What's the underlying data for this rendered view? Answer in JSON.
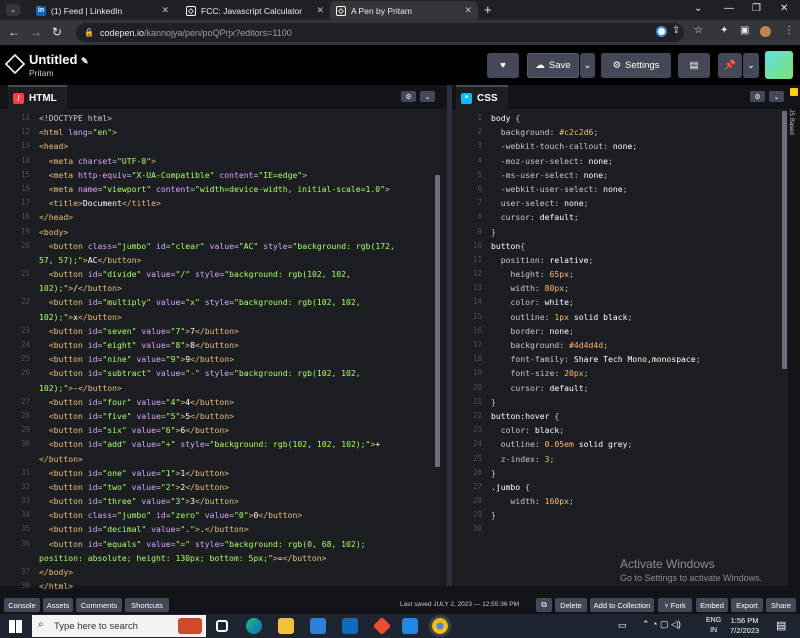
{
  "browser": {
    "tabs": [
      {
        "title": "(1) Feed | LinkedIn",
        "icon": "linkedin-icon"
      },
      {
        "title": "FCC: Javascript Calculator",
        "icon": "codepen-icon"
      },
      {
        "title": "A Pen by Pritam",
        "icon": "codepen-icon"
      }
    ],
    "active_tab": 2,
    "url_host": "codepen.io",
    "url_path": "/kannojya/pen/poQPrjx?editors=1100"
  },
  "pen": {
    "title": "Untitled",
    "user": "Pritam"
  },
  "header": {
    "save_label": "Save",
    "settings_label": "Settings"
  },
  "html_pane": {
    "label": "HTML"
  },
  "css_pane": {
    "label": "CSS",
    "sidebar_label": "JS Based"
  },
  "html_code": [
    {
      "n": "11",
      "html": "<span class='punc'>&lt;!DOCTYPE html&gt;</span>"
    },
    {
      "n": "12",
      "html": "<span class='tag'>&lt;html</span> <span class='attr'>lang</span>=<span class='val'>\"en\"</span><span class='tag'>&gt;</span>"
    },
    {
      "n": "13",
      "html": "<span class='tag'>&lt;head&gt;</span>"
    },
    {
      "n": "14",
      "html": "  <span class='tag'>&lt;meta</span> <span class='attr'>charset</span>=<span class='val'>\"UTF-8\"</span><span class='tag'>&gt;</span>"
    },
    {
      "n": "15",
      "html": "  <span class='tag'>&lt;meta</span> <span class='attr'>http-equiv</span>=<span class='val'>\"X-UA-Compatible\"</span> <span class='attr'>content</span>=<span class='val'>\"IE=edge\"</span><span class='tag'>&gt;</span>"
    },
    {
      "n": "16",
      "html": "  <span class='tag'>&lt;meta</span> <span class='attr'>name</span>=<span class='val'>\"viewport\"</span> <span class='attr'>content</span>=<span class='val'>\"width=device-width, initial-scale=1.0\"</span><span class='tag'>&gt;</span>"
    },
    {
      "n": "17",
      "html": "  <span class='tag'>&lt;title&gt;</span><span class='txt'>Document</span><span class='tag'>&lt;/title&gt;</span>"
    },
    {
      "n": "18",
      "html": "<span class='tag'>&lt;/head&gt;</span>"
    },
    {
      "n": "19",
      "html": "<span class='tag'>&lt;body&gt;</span>"
    },
    {
      "n": "20",
      "html": "  <span class='tag'>&lt;button</span> <span class='attr'>class</span>=<span class='val'>\"jumbo\"</span> <span class='attr'>id</span>=<span class='val'>\"clear\"</span> <span class='attr'>value</span>=<span class='val'>\"AC\"</span> <span class='attr'>style</span>=<span class='val'>\"background: rgb(172,</span>"
    },
    {
      "n": "",
      "html": "<span class='val'>57, 57);\"</span><span class='tag'>&gt;</span><span class='txt'>AC</span><span class='tag'>&lt;/button&gt;</span>"
    },
    {
      "n": "21",
      "html": "  <span class='tag'>&lt;button</span> <span class='attr'>id</span>=<span class='val'>\"divide\"</span> <span class='attr'>value</span>=<span class='val'>\"/\"</span> <span class='attr'>style</span>=<span class='val'>\"background: rgb(102, 102,</span>"
    },
    {
      "n": "",
      "html": "<span class='val'>102);\"</span><span class='tag'>&gt;</span><span class='txt'>/</span><span class='tag'>&lt;/button&gt;</span>"
    },
    {
      "n": "22",
      "html": "  <span class='tag'>&lt;button</span> <span class='attr'>id</span>=<span class='val'>\"multiply\"</span> <span class='attr'>value</span>=<span class='val'>\"x\"</span> <span class='attr'>style</span>=<span class='val'>\"background: rgb(102, 102,</span>"
    },
    {
      "n": "",
      "html": "<span class='val'>102);\"</span><span class='tag'>&gt;</span><span class='txt'>x</span><span class='tag'>&lt;/button&gt;</span>"
    },
    {
      "n": "23",
      "html": "  <span class='tag'>&lt;button</span> <span class='attr'>id</span>=<span class='val'>\"seven\"</span> <span class='attr'>value</span>=<span class='val'>\"7\"</span><span class='tag'>&gt;</span><span class='txt'>7</span><span class='tag'>&lt;/button&gt;</span>"
    },
    {
      "n": "24",
      "html": "  <span class='tag'>&lt;button</span> <span class='attr'>id</span>=<span class='val'>\"eight\"</span> <span class='attr'>value</span>=<span class='val'>\"8\"</span><span class='tag'>&gt;</span><span class='txt'>8</span><span class='tag'>&lt;/button&gt;</span>"
    },
    {
      "n": "25",
      "html": "  <span class='tag'>&lt;button</span> <span class='attr'>id</span>=<span class='val'>\"nine\"</span> <span class='attr'>value</span>=<span class='val'>\"9\"</span><span class='tag'>&gt;</span><span class='txt'>9</span><span class='tag'>&lt;/button&gt;</span>"
    },
    {
      "n": "26",
      "html": "  <span class='tag'>&lt;button</span> <span class='attr'>id</span>=<span class='val'>\"subtract\"</span> <span class='attr'>value</span>=<span class='val'>\"-\"</span> <span class='attr'>style</span>=<span class='val'>\"background: rgb(102, 102,</span>"
    },
    {
      "n": "",
      "html": "<span class='val'>102);\"</span><span class='tag'>&gt;</span><span class='txt'>-</span><span class='tag'>&lt;/button&gt;</span>"
    },
    {
      "n": "27",
      "html": "  <span class='tag'>&lt;button</span> <span class='attr'>id</span>=<span class='val'>\"four\"</span> <span class='attr'>value</span>=<span class='val'>\"4\"</span><span class='tag'>&gt;</span><span class='txt'>4</span><span class='tag'>&lt;/button&gt;</span>"
    },
    {
      "n": "28",
      "html": "  <span class='tag'>&lt;button</span> <span class='attr'>id</span>=<span class='val'>\"five\"</span> <span class='attr'>value</span>=<span class='val'>\"5\"</span><span class='tag'>&gt;</span><span class='txt'>5</span><span class='tag'>&lt;/button&gt;</span>"
    },
    {
      "n": "29",
      "html": "  <span class='tag'>&lt;button</span> <span class='attr'>id</span>=<span class='val'>\"six\"</span> <span class='attr'>value</span>=<span class='val'>\"6\"</span><span class='tag'>&gt;</span><span class='txt'>6</span><span class='tag'>&lt;/button&gt;</span>"
    },
    {
      "n": "30",
      "html": "  <span class='tag'>&lt;button</span> <span class='attr'>id</span>=<span class='val'>\"add\"</span> <span class='attr'>value</span>=<span class='val'>\"+\"</span> <span class='attr'>style</span>=<span class='val'>\"background: rgb(102, 102, 102);\"</span><span class='tag'>&gt;</span><span class='txt'>+</span>"
    },
    {
      "n": "",
      "html": "<span class='tag'>&lt;/button&gt;</span>"
    },
    {
      "n": "31",
      "html": "  <span class='tag'>&lt;button</span> <span class='attr'>id</span>=<span class='val'>\"one\"</span> <span class='attr'>value</span>=<span class='val'>\"1\"</span><span class='tag'>&gt;</span><span class='txt'>1</span><span class='tag'>&lt;/button&gt;</span>"
    },
    {
      "n": "32",
      "html": "  <span class='tag'>&lt;button</span> <span class='attr'>id</span>=<span class='val'>\"two\"</span> <span class='attr'>value</span>=<span class='val'>\"2\"</span><span class='tag'>&gt;</span><span class='txt'>2</span><span class='tag'>&lt;/button&gt;</span>"
    },
    {
      "n": "33",
      "html": "  <span class='tag'>&lt;button</span> <span class='attr'>id</span>=<span class='val'>\"three\"</span> <span class='attr'>value</span>=<span class='val'>\"3\"</span><span class='tag'>&gt;</span><span class='txt'>3</span><span class='tag'>&lt;/button&gt;</span>"
    },
    {
      "n": "34",
      "html": "  <span class='tag'>&lt;button</span> <span class='attr'>class</span>=<span class='val'>\"jumbo\"</span> <span class='attr'>id</span>=<span class='val'>\"zero\"</span> <span class='attr'>value</span>=<span class='val'>\"0\"</span><span class='tag'>&gt;</span><span class='txt'>0</span><span class='tag'>&lt;/button&gt;</span>"
    },
    {
      "n": "35",
      "html": "  <span class='tag'>&lt;button</span> <span class='attr'>id</span>=<span class='val'>\"decimal\"</span> <span class='attr'>value</span>=<span class='val'>\".\"</span><span class='tag'>&gt;</span><span class='txt'>.</span><span class='tag'>&lt;/button&gt;</span>"
    },
    {
      "n": "36",
      "html": "  <span class='tag'>&lt;button</span> <span class='attr'>id</span>=<span class='val'>\"equals\"</span> <span class='attr'>value</span>=<span class='val'>\"=\"</span> <span class='attr'>style</span>=<span class='val'>\"background: rgb(0, 68, 102);</span>"
    },
    {
      "n": "",
      "html": "<span class='val'>position: absolute; height: 130px; bottom: 5px;\"</span><span class='tag'>&gt;</span><span class='txt'>=</span><span class='tag'>&lt;/button&gt;</span>"
    },
    {
      "n": "37",
      "html": "<span class='tag'>&lt;/body&gt;</span>"
    },
    {
      "n": "38",
      "html": "<span class='tag'>&lt;/html&gt;</span>"
    }
  ],
  "css_code": [
    {
      "n": "1",
      "html": "<span class='sel'>body</span> <span class='punc'>{</span>"
    },
    {
      "n": "2",
      "html": "  <span class='prop'>background</span>: <span class='num'>#c2c2d6</span>;"
    },
    {
      "n": "3",
      "html": "  <span class='prop'>-webkit-touch-callout</span>: <span class='cval'>none</span>;"
    },
    {
      "n": "4",
      "html": "  <span class='prop'>-moz-user-select</span>: <span class='cval'>none</span>;"
    },
    {
      "n": "5",
      "html": "  <span class='prop'>-ms-user-select</span>: <span class='cval'>none</span>;"
    },
    {
      "n": "6",
      "html": "  <span class='prop'>-webkit-user-select</span>: <span class='cval'>none</span>;"
    },
    {
      "n": "7",
      "html": "  <span class='prop'>user-select</span>: <span class='cval'>none</span>;"
    },
    {
      "n": "8",
      "html": "  <span class='prop'>cursor</span>: <span class='cval'>default</span>;"
    },
    {
      "n": "9",
      "html": "<span class='punc'>}</span>"
    },
    {
      "n": "10",
      "html": "<span class='sel'>button</span><span class='punc'>{</span>"
    },
    {
      "n": "11",
      "html": "  <span class='prop'>position</span>: <span class='cval'>relative</span>;"
    },
    {
      "n": "12",
      "html": "    <span class='prop'>height</span>: <span class='num'>65px</span>;"
    },
    {
      "n": "13",
      "html": "    <span class='prop'>width</span>: <span class='num'>80px</span>;"
    },
    {
      "n": "14",
      "html": "    <span class='prop'>color</span>: <span class='cval'>white</span>;"
    },
    {
      "n": "15",
      "html": "    <span class='prop'>outline</span>: <span class='num'>1px</span> <span class='cval'>solid black</span>;"
    },
    {
      "n": "16",
      "html": "    <span class='prop'>border</span>: <span class='cval'>none</span>;"
    },
    {
      "n": "17",
      "html": "    <span class='prop'>background</span>: <span class='num'>#4d4d4d</span>;"
    },
    {
      "n": "18",
      "html": "    <span class='prop'>font-family</span>: <span class='cval'>Share Tech Mono,monospace</span>;"
    },
    {
      "n": "19",
      "html": "    <span class='prop'>font-size</span>: <span class='num'>20px</span>;"
    },
    {
      "n": "20",
      "html": "    <span class='prop'>cursor</span>: <span class='cval'>default</span>;"
    },
    {
      "n": "21",
      "html": "<span class='punc'>}</span>"
    },
    {
      "n": "22",
      "html": "<span class='sel'>button:hover</span> <span class='punc'>{</span>"
    },
    {
      "n": "23",
      "html": "  <span class='prop'>color</span>: <span class='cval'>black</span>;"
    },
    {
      "n": "24",
      "html": "  <span class='prop'>outline</span>: <span class='num'>0.05em</span> <span class='cval'>solid grey</span>;"
    },
    {
      "n": "25",
      "html": "  <span class='prop'>z-index</span>: <span class='num'>3</span>;"
    },
    {
      "n": "26",
      "html": "<span class='punc'>}</span>"
    },
    {
      "n": "27",
      "html": "<span class='sel'>.jumbo</span> <span class='punc'>{</span>"
    },
    {
      "n": "28",
      "html": "    <span class='prop'>width</span>: <span class='num'>160px</span>;"
    },
    {
      "n": "29",
      "html": "<span class='punc'>}</span>"
    },
    {
      "n": "30",
      "html": ""
    }
  ],
  "footer": {
    "left_buttons": [
      "Console",
      "Assets",
      "Comments",
      "Shortcuts"
    ],
    "saved_text": "Last saved JULY 2, 2023 — 12:55:36 PM",
    "right_buttons": [
      "Delete",
      "Add to Collection",
      "Fork",
      "Embed",
      "Export",
      "Share"
    ]
  },
  "activate": {
    "title": "Activate Windows",
    "subtitle": "Go to Settings to activate Windows."
  },
  "taskbar": {
    "search_placeholder": "Type here to search",
    "lang1": "ENG",
    "lang2": "IN",
    "time": "1:56 PM",
    "date": "7/2/2023"
  },
  "colors": {
    "codepen_bg": "#131417",
    "pane_bg": "#1d1e22",
    "button_bg": "#444857",
    "html_icon": "#ff3c41",
    "css_icon": "#0ebeff"
  }
}
